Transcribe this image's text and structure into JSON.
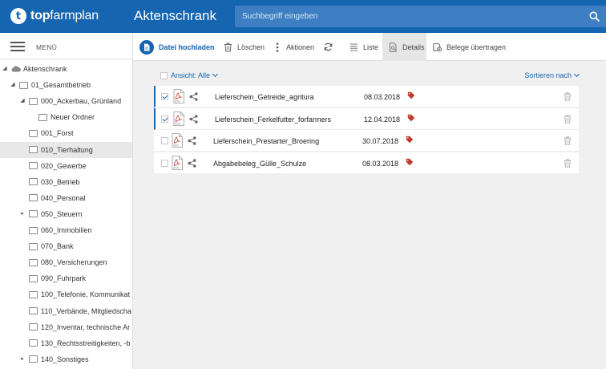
{
  "header": {
    "logo_bold": "top",
    "logo_rest": "farmplan",
    "logo_mark": "t",
    "title": "Aktenschrank",
    "search_placeholder": "Suchbegriff eingeben"
  },
  "sidebar": {
    "menu_label": "MENÜ",
    "tree": [
      {
        "label": "Aktenschrank",
        "level": 0,
        "toggle": "expanded",
        "icon": "cloud-icon"
      },
      {
        "label": "01_Gesamtbetrieb",
        "level": 1,
        "toggle": "expanded",
        "icon": "folder-icon"
      },
      {
        "label": "000_Ackerbau, Grünland",
        "level": 2,
        "toggle": "expanded",
        "icon": "folder-icon"
      },
      {
        "label": "Neuer Ordner",
        "level": 3,
        "toggle": "none",
        "icon": "folder-icon"
      },
      {
        "label": "001_Forst",
        "level": 2,
        "toggle": "none",
        "icon": "folder-icon"
      },
      {
        "label": "010_Tierhaltung",
        "level": 2,
        "toggle": "none",
        "icon": "folder-icon",
        "selected": true
      },
      {
        "label": "020_Gewerbe",
        "level": 2,
        "toggle": "none",
        "icon": "folder-icon"
      },
      {
        "label": "030_Betrieb",
        "level": 2,
        "toggle": "none",
        "icon": "folder-icon"
      },
      {
        "label": "040_Personal",
        "level": 2,
        "toggle": "none",
        "icon": "folder-icon"
      },
      {
        "label": "050_Steuern",
        "level": 2,
        "toggle": "collapsed",
        "icon": "folder-icon"
      },
      {
        "label": "060_Immobilien",
        "level": 2,
        "toggle": "none",
        "icon": "folder-icon"
      },
      {
        "label": "070_Bank",
        "level": 2,
        "toggle": "none",
        "icon": "folder-icon"
      },
      {
        "label": "080_Versicherungen",
        "level": 2,
        "toggle": "none",
        "icon": "folder-icon"
      },
      {
        "label": "090_Fuhrpark",
        "level": 2,
        "toggle": "none",
        "icon": "folder-icon"
      },
      {
        "label": "100_Telefonie, Kommunikat",
        "level": 2,
        "toggle": "none",
        "icon": "folder-icon"
      },
      {
        "label": "110_Verbände, Mitgliedscha",
        "level": 2,
        "toggle": "none",
        "icon": "folder-icon"
      },
      {
        "label": "120_Inventar, technische Ar",
        "level": 2,
        "toggle": "none",
        "icon": "folder-icon"
      },
      {
        "label": "130_Rechtsstreitigkeiten, -b",
        "level": 2,
        "toggle": "none",
        "icon": "folder-icon"
      },
      {
        "label": "140_Sonstiges",
        "level": 2,
        "toggle": "collapsed",
        "icon": "folder-icon"
      }
    ]
  },
  "toolbar": {
    "upload": "Datei hochladen",
    "delete": "Löschen",
    "actions": "Aktionen",
    "list": "Liste",
    "details": "Details",
    "transfer": "Belege übertragen"
  },
  "list": {
    "view_label": "Ansicht: Alle",
    "sort_label": "Sortieren nach",
    "files": [
      {
        "name": "Lieferschein_Getreide_agritura",
        "date": "08.03.2018",
        "checked": true
      },
      {
        "name": "Lieferschein_Ferkelfutter_forfarmers",
        "date": "12.04.2018",
        "checked": true
      },
      {
        "name": "Lieferschein_Prestarter_Broering",
        "date": "30.07.2018",
        "checked": false
      },
      {
        "name": "Abgabebeleg_Gülle_Schulze",
        "date": "08.03.2018",
        "checked": false
      }
    ]
  },
  "colors": {
    "brand": "#1565b0",
    "tag": "#c0392b"
  }
}
